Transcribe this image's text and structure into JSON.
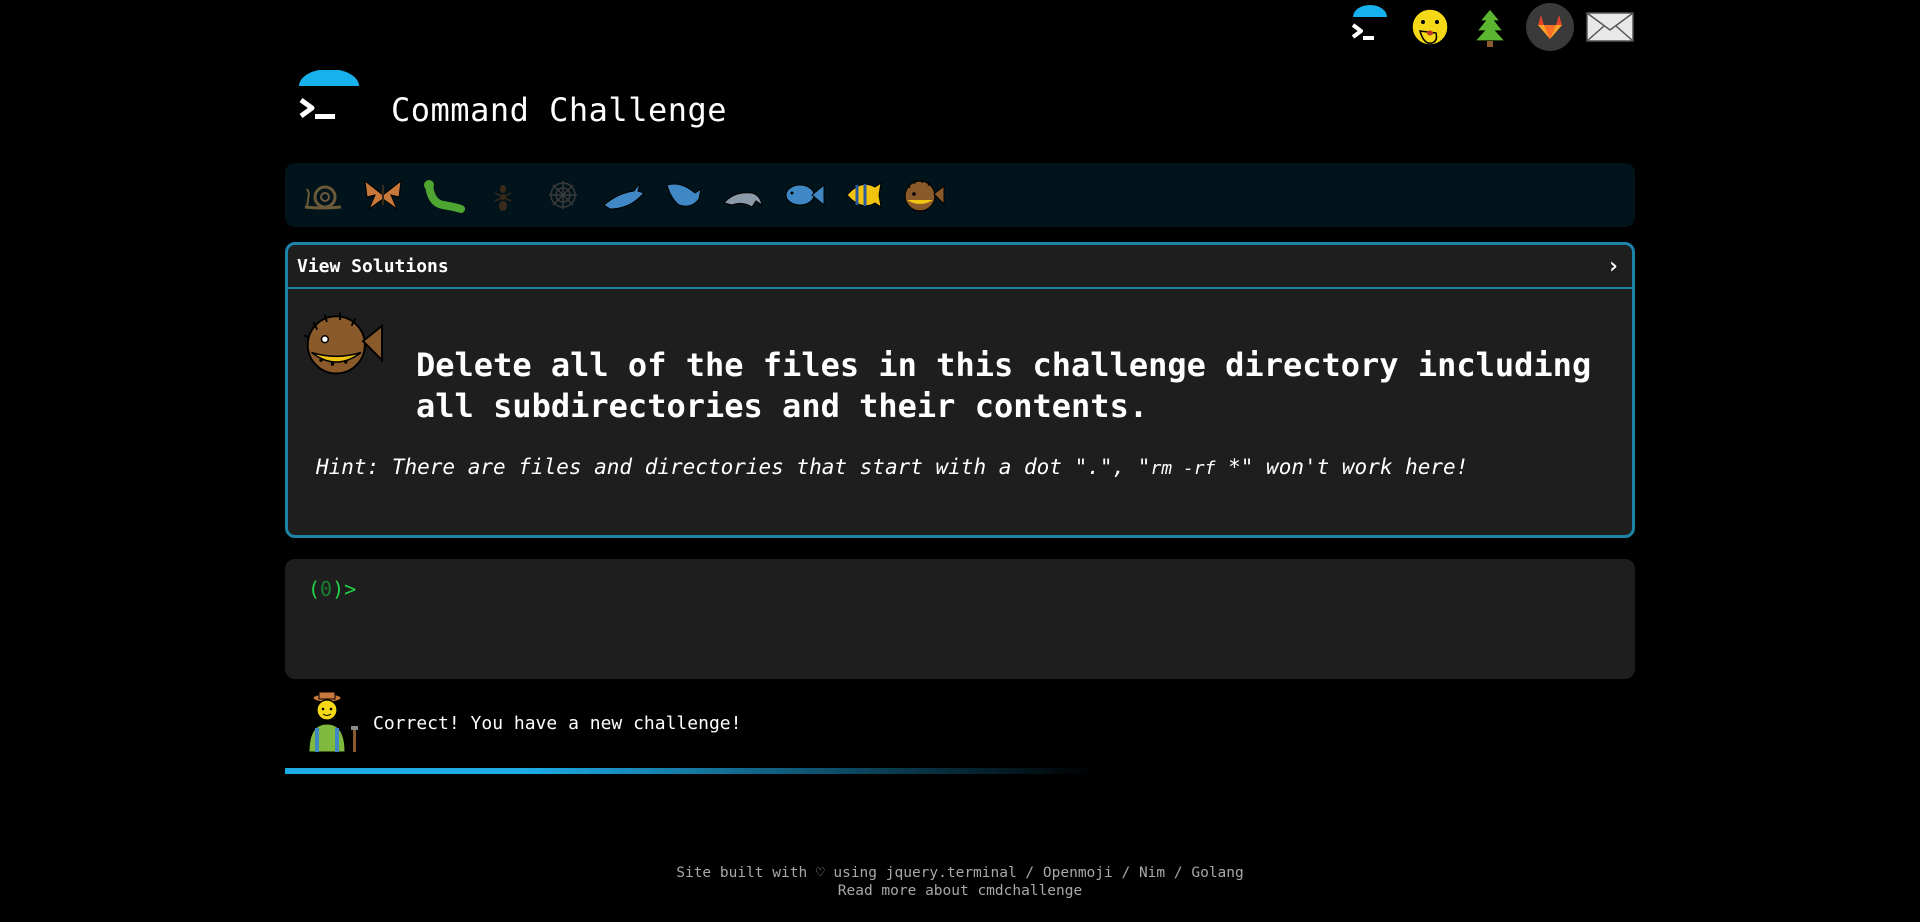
{
  "header": {
    "title": "Command Challenge"
  },
  "top_icons": [
    {
      "name": "terminal-logo-icon"
    },
    {
      "name": "face-hand-over-mouth-icon"
    },
    {
      "name": "tree-icon"
    },
    {
      "name": "gitlab-icon"
    },
    {
      "name": "envelope-icon"
    }
  ],
  "levels": [
    {
      "name": "snail-icon"
    },
    {
      "name": "butterfly-icon"
    },
    {
      "name": "caterpillar-icon"
    },
    {
      "name": "ant-icon"
    },
    {
      "name": "spider-web-icon"
    },
    {
      "name": "whale-icon"
    },
    {
      "name": "shark-icon"
    },
    {
      "name": "dolphin-icon"
    },
    {
      "name": "fish-icon"
    },
    {
      "name": "tropical-fish-icon"
    },
    {
      "name": "blowfish-icon"
    }
  ],
  "card": {
    "head_label": "View Solutions",
    "chevron": "›",
    "challenge": "Delete all of the files in this challenge directory including all subdirectories and their contents.",
    "hint_prefix": "Hint: There are files and directories that start with a dot \".\", \"",
    "hint_code": "rm -rf",
    "hint_suffix": " *\" won't work here!"
  },
  "terminal": {
    "prompt_open": "(",
    "prompt_num": "0",
    "prompt_close": ")>"
  },
  "status": {
    "text": "Correct! You have a new challenge!"
  },
  "footer": {
    "line1_prefix": "Site built with ♡ using ",
    "link_jquery": "jquery.terminal",
    "sep1": " / ",
    "link_openmoji": "Openmoji",
    "sep2": " / ",
    "link_nim": "Nim",
    "sep3": " / ",
    "link_golang": "Golang",
    "link_readmore": "Read more about cmdchallenge"
  },
  "colors": {
    "accent": "#1d83a8",
    "terminal_green": "#22d34a",
    "bar_bg": "#02141b",
    "card_bg": "#1e1e1e"
  }
}
